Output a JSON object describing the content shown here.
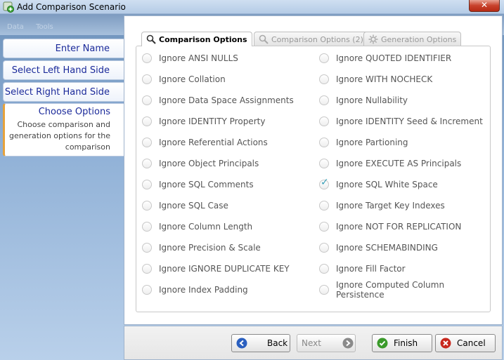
{
  "window": {
    "title": "Add Comparison Scenario",
    "close_label": "✕"
  },
  "header": {
    "faint_menu": [
      "Data",
      "Tools"
    ]
  },
  "steps": [
    {
      "label": "Enter Name"
    },
    {
      "label": "Select Left Hand Side"
    },
    {
      "label": "Select Right Hand Side"
    }
  ],
  "active_step": {
    "label": "Choose Options",
    "description": "Choose comparison and generation options for the comparison"
  },
  "tabs": [
    {
      "label": "Comparison Options",
      "icon": "magnifier-icon",
      "active": true
    },
    {
      "label": "Comparison Options (2)",
      "icon": "magnifier-icon",
      "active": false
    },
    {
      "label": "Generation Options",
      "icon": "gear-icon",
      "active": false
    }
  ],
  "options_left": [
    {
      "label": "Ignore ANSI NULLS",
      "checked": false
    },
    {
      "label": "Ignore Collation",
      "checked": false
    },
    {
      "label": "Ignore Data Space Assignments",
      "checked": false
    },
    {
      "label": "Ignore IDENTITY Property",
      "checked": false
    },
    {
      "label": "Ignore Referential Actions",
      "checked": false
    },
    {
      "label": "Ignore Object Principals",
      "checked": false
    },
    {
      "label": "Ignore SQL Comments",
      "checked": false
    },
    {
      "label": "Ignore SQL Case",
      "checked": false
    },
    {
      "label": "Ignore Column Length",
      "checked": false
    },
    {
      "label": "Ignore Precision & Scale",
      "checked": false
    },
    {
      "label": "Ignore IGNORE DUPLICATE KEY",
      "checked": false
    },
    {
      "label": "Ignore Index Padding",
      "checked": false
    }
  ],
  "options_right": [
    {
      "label": "Ignore QUOTED IDENTIFIER",
      "checked": false
    },
    {
      "label": "Ignore WITH NOCHECK",
      "checked": false
    },
    {
      "label": "Ignore Nullability",
      "checked": false
    },
    {
      "label": "Ignore IDENTITY Seed & Increment",
      "checked": false
    },
    {
      "label": "Ignore Partioning",
      "checked": false
    },
    {
      "label": "Ignore EXECUTE AS Principals",
      "checked": false
    },
    {
      "label": "Ignore SQL White Space",
      "checked": true
    },
    {
      "label": "Ignore Target Key Indexes",
      "checked": false
    },
    {
      "label": "Ignore NOT FOR REPLICATION",
      "checked": false
    },
    {
      "label": "Ignore SCHEMABINDING",
      "checked": false
    },
    {
      "label": "Ignore Fill Factor",
      "checked": false
    },
    {
      "label": "Ignore Computed Column Persistence",
      "checked": false
    }
  ],
  "buttons": {
    "back": {
      "label": "Back",
      "icon": "arrow-left-icon",
      "color": "#2a5fbf"
    },
    "next": {
      "label": "Next",
      "icon": "arrow-right-icon",
      "color": "#8a8a8a"
    },
    "finish": {
      "label": "Finish",
      "icon": "check-icon",
      "color": "#3a9a2a"
    },
    "cancel": {
      "label": "Cancel",
      "icon": "cross-icon",
      "color": "#c8281e"
    }
  }
}
